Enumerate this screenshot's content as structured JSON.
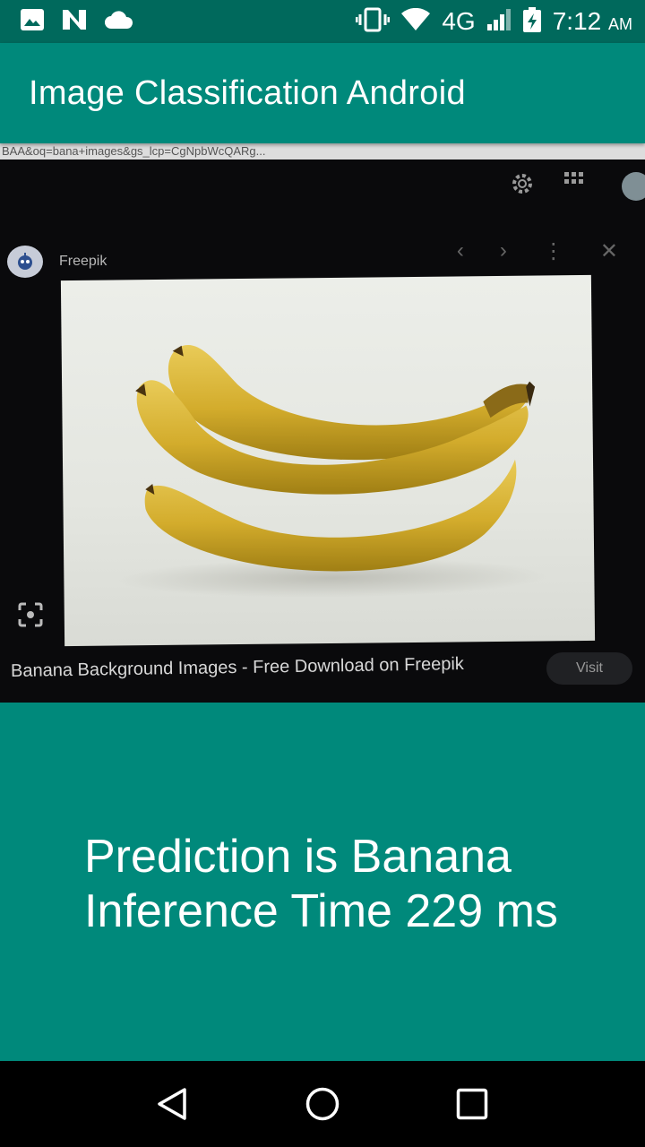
{
  "status_bar": {
    "icons_left": [
      "image-icon",
      "n-notification-icon",
      "cloud-icon"
    ],
    "icons_right": [
      "vibrate-icon",
      "wifi-icon",
      "signal-icon",
      "battery-charging-icon"
    ],
    "network": "4G",
    "time": "7:12",
    "ampm": "AM"
  },
  "app_bar": {
    "title": "Image Classification Android"
  },
  "camera_preview": {
    "url_text": "BAA&oq=bana+images&gs_lcp=CgNpbWcQARg...",
    "source_label": "Freepik",
    "caption": "Banana Background Images - Free Download on Freepik",
    "visit_label": "Visit"
  },
  "result": {
    "prediction": "Prediction is Banana",
    "inference_time": "Inference Time 229 ms"
  },
  "nav_bar": {
    "buttons": [
      "back",
      "home",
      "recents"
    ]
  },
  "colors": {
    "status_bar": "#00695c",
    "primary": "#00897b"
  }
}
